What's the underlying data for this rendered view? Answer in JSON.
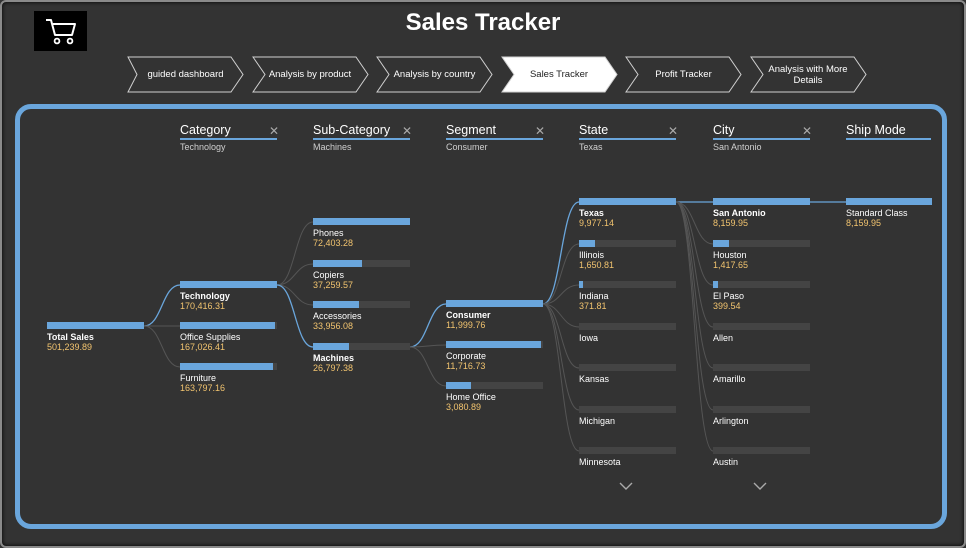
{
  "app": {
    "title": "Sales Tracker",
    "logo_icon": "shopping-cart-icon"
  },
  "nav": [
    {
      "label": "guided dashboard",
      "active": false
    },
    {
      "label": "Analysis by product",
      "active": false
    },
    {
      "label": "Analysis by country",
      "active": false
    },
    {
      "label": "Sales Tracker",
      "active": true
    },
    {
      "label": "Profit Tracker",
      "active": false
    },
    {
      "label": "Analysis with More Details",
      "active": false
    }
  ],
  "colors": {
    "accent": "#6aa6dc",
    "value": "#f2c46f",
    "background": "#333333"
  },
  "tree": {
    "root": {
      "name": "Total Sales",
      "value": "501,239.89",
      "fraction": 1.0
    },
    "columns": [
      {
        "label": "Category",
        "selected": "Technology",
        "clear": "✕",
        "nodes": [
          {
            "name": "Technology",
            "value": "170,416.31",
            "fraction": 1.0,
            "selected": true
          },
          {
            "name": "Office Supplies",
            "value": "167,026.41",
            "fraction": 0.98,
            "selected": false
          },
          {
            "name": "Furniture",
            "value": "163,797.16",
            "fraction": 0.96,
            "selected": false
          }
        ]
      },
      {
        "label": "Sub-Category",
        "selected": "Machines",
        "clear": "✕",
        "nodes": [
          {
            "name": "Phones",
            "value": "72,403.28",
            "fraction": 1.0,
            "selected": false
          },
          {
            "name": "Copiers",
            "value": "37,259.57",
            "fraction": 0.51,
            "selected": false
          },
          {
            "name": "Accessories",
            "value": "33,956.08",
            "fraction": 0.47,
            "selected": false
          },
          {
            "name": "Machines",
            "value": "26,797.38",
            "fraction": 0.37,
            "selected": true
          }
        ]
      },
      {
        "label": "Segment",
        "selected": "Consumer",
        "clear": "✕",
        "nodes": [
          {
            "name": "Consumer",
            "value": "11,999.76",
            "fraction": 1.0,
            "selected": true
          },
          {
            "name": "Corporate",
            "value": "11,716.73",
            "fraction": 0.98,
            "selected": false
          },
          {
            "name": "Home Office",
            "value": "3,080.89",
            "fraction": 0.26,
            "selected": false
          }
        ]
      },
      {
        "label": "State",
        "selected": "Texas",
        "clear": "✕",
        "more": "⌄",
        "nodes": [
          {
            "name": "Texas",
            "value": "9,977.14",
            "fraction": 1.0,
            "selected": true
          },
          {
            "name": "Illinois",
            "value": "1,650.81",
            "fraction": 0.17,
            "selected": false
          },
          {
            "name": "Indiana",
            "value": "371.81",
            "fraction": 0.04,
            "selected": false
          },
          {
            "name": "Iowa",
            "value": "",
            "fraction": 0,
            "selected": false
          },
          {
            "name": "Kansas",
            "value": "",
            "fraction": 0,
            "selected": false
          },
          {
            "name": "Michigan",
            "value": "",
            "fraction": 0,
            "selected": false
          },
          {
            "name": "Minnesota",
            "value": "",
            "fraction": 0,
            "selected": false
          }
        ]
      },
      {
        "label": "City",
        "selected": "San Antonio",
        "clear": "✕",
        "more": "⌄",
        "nodes": [
          {
            "name": "San Antonio",
            "value": "8,159.95",
            "fraction": 1.0,
            "selected": true
          },
          {
            "name": "Houston",
            "value": "1,417.65",
            "fraction": 0.17,
            "selected": false
          },
          {
            "name": "El Paso",
            "value": "399.54",
            "fraction": 0.05,
            "selected": false
          },
          {
            "name": "Allen",
            "value": "",
            "fraction": 0,
            "selected": false
          },
          {
            "name": "Amarillo",
            "value": "",
            "fraction": 0,
            "selected": false
          },
          {
            "name": "Arlington",
            "value": "",
            "fraction": 0,
            "selected": false
          },
          {
            "name": "Austin",
            "value": "",
            "fraction": 0,
            "selected": false
          }
        ]
      },
      {
        "label": "Ship Mode",
        "selected": "",
        "nodes": [
          {
            "name": "Standard Class",
            "value": "8,159.95",
            "fraction": 1.0,
            "selected": false
          }
        ]
      }
    ]
  }
}
